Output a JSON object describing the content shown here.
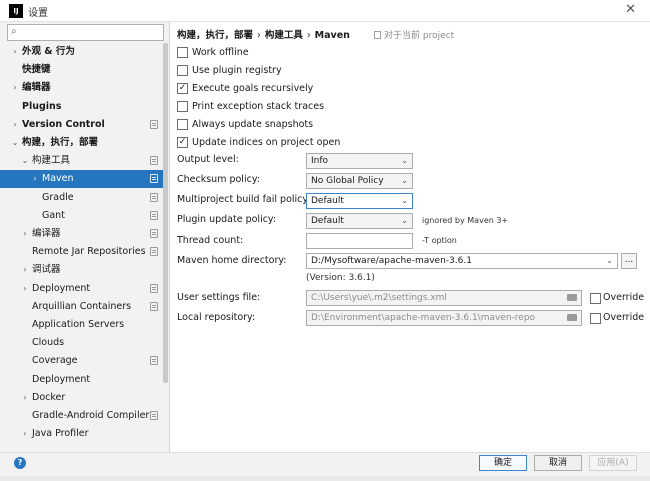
{
  "window": {
    "title": "设置",
    "app_icon": "intellij-icon",
    "close_glyph": "✕"
  },
  "search": {
    "placeholder": ""
  },
  "sidebar": {
    "items": [
      {
        "label": "外观 & 行为",
        "arrow": "›",
        "bold": true,
        "indent": 0,
        "badge": false
      },
      {
        "label": "快捷键",
        "arrow": "",
        "bold": true,
        "indent": 0,
        "badge": false
      },
      {
        "label": "编辑器",
        "arrow": "›",
        "bold": true,
        "indent": 0,
        "badge": false
      },
      {
        "label": "Plugins",
        "arrow": "",
        "bold": true,
        "indent": 0,
        "badge": false
      },
      {
        "label": "Version Control",
        "arrow": "›",
        "bold": true,
        "indent": 0,
        "badge": true
      },
      {
        "label": "构建，执行，部署",
        "arrow": "⌄",
        "bold": true,
        "indent": 0,
        "badge": false
      },
      {
        "label": "构建工具",
        "arrow": "⌄",
        "bold": false,
        "indent": 1,
        "badge": true
      },
      {
        "label": "Maven",
        "arrow": "›",
        "bold": false,
        "indent": 2,
        "badge": true,
        "selected": true
      },
      {
        "label": "Gradle",
        "arrow": "",
        "bold": false,
        "indent": 2,
        "badge": true
      },
      {
        "label": "Gant",
        "arrow": "",
        "bold": false,
        "indent": 2,
        "badge": true
      },
      {
        "label": "编译器",
        "arrow": "›",
        "bold": false,
        "indent": 1,
        "badge": true
      },
      {
        "label": "Remote Jar Repositories",
        "arrow": "",
        "bold": false,
        "indent": 1,
        "badge": true
      },
      {
        "label": "调试器",
        "arrow": "›",
        "bold": false,
        "indent": 1,
        "badge": false
      },
      {
        "label": "Deployment",
        "arrow": "›",
        "bold": false,
        "indent": 1,
        "badge": true
      },
      {
        "label": "Arquillian Containers",
        "arrow": "",
        "bold": false,
        "indent": 1,
        "badge": true
      },
      {
        "label": "Application Servers",
        "arrow": "",
        "bold": false,
        "indent": 1,
        "badge": false
      },
      {
        "label": "Clouds",
        "arrow": "",
        "bold": false,
        "indent": 1,
        "badge": false
      },
      {
        "label": "Coverage",
        "arrow": "",
        "bold": false,
        "indent": 1,
        "badge": true
      },
      {
        "label": "Deployment",
        "arrow": "",
        "bold": false,
        "indent": 1,
        "badge": false
      },
      {
        "label": "Docker",
        "arrow": "›",
        "bold": false,
        "indent": 1,
        "badge": false
      },
      {
        "label": "Gradle-Android Compiler",
        "arrow": "",
        "bold": false,
        "indent": 1,
        "badge": true
      },
      {
        "label": "Java Profiler",
        "arrow": "›",
        "bold": false,
        "indent": 1,
        "badge": false
      }
    ]
  },
  "breadcrumb": {
    "part1": "构建，执行，部署",
    "sep": "›",
    "part2": "构建工具",
    "part3": "Maven"
  },
  "scope_note": "对于当前 project",
  "checkboxes": [
    {
      "label": "Work offline",
      "checked": false
    },
    {
      "label": "Use plugin registry",
      "checked": false
    },
    {
      "label": "Execute goals recursively",
      "checked": true
    },
    {
      "label": "Print exception stack traces",
      "checked": false
    },
    {
      "label": "Always update snapshots",
      "checked": false
    },
    {
      "label": "Update indices on project open",
      "checked": true
    }
  ],
  "fields": {
    "output_level_label": "Output level:",
    "output_level_value": "Info",
    "checksum_label": "Checksum policy:",
    "checksum_value": "No Global Policy",
    "multiproject_label": "Multiproject build fail policy:",
    "multiproject_value": "Default",
    "plugin_update_label": "Plugin update policy:",
    "plugin_update_value": "Default",
    "plugin_update_hint": "ignored by Maven 3+",
    "thread_count_label": "Thread count:",
    "thread_count_value": "",
    "thread_count_hint": "-T option",
    "maven_home_label": "Maven home directory:",
    "maven_home_value": "D:/Mysoftware/apache-maven-3.6.1",
    "maven_version": "(Version: 3.6.1)",
    "browse_label": "...",
    "user_settings_label": "User settings file:",
    "user_settings_value": "C:\\Users\\yue\\.m2\\settings.xml",
    "local_repo_label": "Local repository:",
    "local_repo_value": "D:\\Environment\\apache-maven-3.6.1\\maven-repo",
    "override_label": "Override"
  },
  "footer": {
    "ok": "确定",
    "cancel": "取消",
    "apply": "应用(A)",
    "help": "?"
  },
  "colors": {
    "selection": "#2675bf",
    "accent_border": "#3d86d4"
  }
}
